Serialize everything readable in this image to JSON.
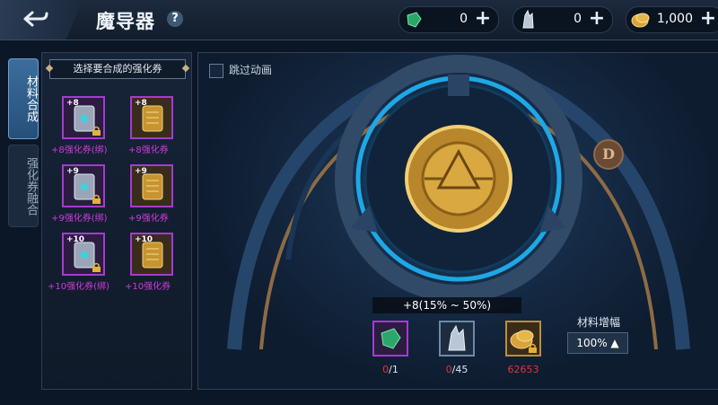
{
  "header": {
    "title": "魔导器",
    "help": "?"
  },
  "resources": [
    {
      "icon": "green-gem-icon",
      "value": "0"
    },
    {
      "icon": "crystal-icon",
      "value": "0"
    },
    {
      "icon": "gold-coin-icon",
      "value": "1,000"
    }
  ],
  "side_tabs": [
    {
      "label": "材料合成",
      "active": true
    },
    {
      "label": "强化券融合",
      "active": false
    }
  ],
  "panel": {
    "title": "选择要合成的强化券",
    "items": [
      {
        "tag": "+8",
        "label": "+8强化券(绑)",
        "type": "silver"
      },
      {
        "tag": "+8",
        "label": "+8强化券",
        "type": "gold"
      },
      {
        "tag": "+9",
        "label": "+9强化券(绑)",
        "type": "silver"
      },
      {
        "tag": "+9",
        "label": "+9强化券",
        "type": "gold"
      },
      {
        "tag": "+10",
        "label": "+10强化券(绑)",
        "type": "silver"
      },
      {
        "tag": "+10",
        "label": "+10强化券",
        "type": "gold"
      }
    ]
  },
  "main": {
    "skip_label": "跳过动画",
    "success_rate": "+8(15% ~ 50%)",
    "materials": [
      {
        "icon": "green-gem-icon",
        "have": "0",
        "need": "/1"
      },
      {
        "icon": "crystal-icon",
        "have": "0",
        "need": "/45"
      },
      {
        "icon": "gold-coin-icon",
        "have": "62653",
        "need": ""
      }
    ],
    "amp_label": "材料增幅",
    "amp_value": "100% ▲",
    "badge": "D"
  },
  "colors": {
    "accent": "#3c6d9c",
    "purple": "#a33ccf",
    "red": "#e0343a",
    "gold": "#c9a14a"
  }
}
